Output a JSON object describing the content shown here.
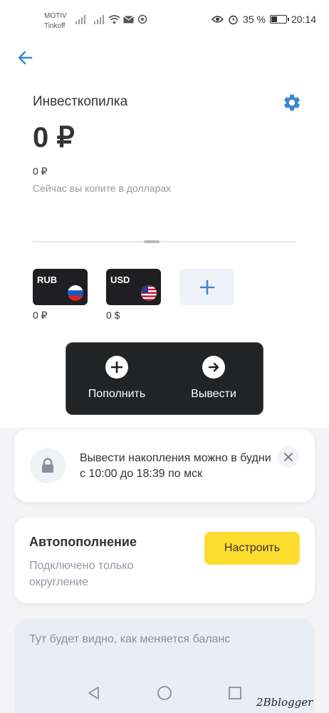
{
  "status_bar": {
    "carrier_line1": "MOTIV",
    "carrier_line2": "Tinkoff",
    "battery_text": "35 %",
    "battery_level": 0.35,
    "time": "20:14",
    "icons": [
      "signal-icon",
      "wifi-icon",
      "mail-icon",
      "bell-icon",
      "eye-icon",
      "alarm-icon",
      "battery-icon"
    ]
  },
  "header": {
    "back_icon": "arrow-left-icon",
    "title": "Инвесткопилка",
    "settings_icon": "gear-icon"
  },
  "summary": {
    "amount": "0 ₽",
    "sub_amount": "0 ₽",
    "hint": "Сейчас вы копите в долларах"
  },
  "currencies": [
    {
      "code": "RUB",
      "balance": "0 ₽",
      "flag": "russia-flag-icon"
    },
    {
      "code": "USD",
      "balance": "0 $",
      "flag": "usa-flag-icon"
    }
  ],
  "add_currency_icon": "plus-icon",
  "actions": {
    "topup_label": "Пополнить",
    "withdraw_label": "Вывести"
  },
  "notice": {
    "text": "Вывести накопления можно в будни с 10:00 до 18:39 по мск",
    "icon": "lock-icon",
    "close_icon": "close-icon"
  },
  "autofill": {
    "title": "Автопополнение",
    "subtitle": "Подключено только округление",
    "button_label": "Настроить"
  },
  "balance_chart": {
    "placeholder": "Тут будет видно, как меняется баланс"
  },
  "nav": [
    "back-triangle-icon",
    "home-circle-icon",
    "recents-square-icon"
  ],
  "watermark": "2Bblogger",
  "colors": {
    "accent": "#3a86d6",
    "yellow_button": "#fddd2d",
    "dark_panel": "#222325"
  }
}
